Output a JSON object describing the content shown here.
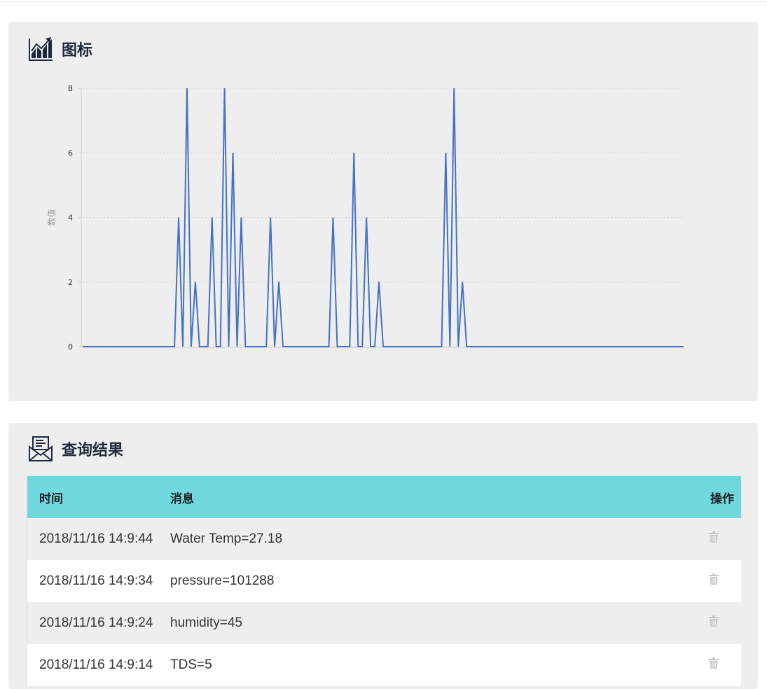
{
  "chart_panel": {
    "title": "图标",
    "icon": "trending-chart-icon"
  },
  "chart_data": {
    "type": "line",
    "ylabel": "数值",
    "ylim": [
      0,
      8
    ],
    "yticks": [
      0,
      2,
      4,
      6,
      8
    ],
    "grid": true,
    "color": "#4472c4",
    "values": [
      0,
      0,
      0,
      0,
      0,
      0,
      0,
      0,
      0,
      0,
      0,
      0,
      0,
      0,
      0,
      0,
      0,
      0,
      0,
      0,
      0,
      0,
      0,
      4,
      0,
      8,
      0,
      2,
      0,
      0,
      0,
      4,
      0,
      0,
      8,
      0,
      6,
      0,
      4,
      0,
      0,
      0,
      0,
      0,
      0,
      4,
      0,
      2,
      0,
      0,
      0,
      0,
      0,
      0,
      0,
      0,
      0,
      0,
      0,
      0,
      4,
      0,
      0,
      0,
      0,
      6,
      0,
      0,
      4,
      0,
      0,
      2,
      0,
      0,
      0,
      0,
      0,
      0,
      0,
      0,
      0,
      0,
      0,
      0,
      0,
      0,
      0,
      6,
      0,
      8,
      0,
      2,
      0,
      0,
      0,
      0,
      0,
      0,
      0,
      0,
      0,
      0,
      0,
      0,
      0,
      0,
      0,
      0,
      0,
      0,
      0,
      0,
      0,
      0,
      0,
      0,
      0,
      0,
      0,
      0,
      0,
      0,
      0,
      0,
      0,
      0,
      0,
      0,
      0,
      0,
      0,
      0,
      0,
      0,
      0,
      0,
      0,
      0,
      0,
      0,
      0,
      0,
      0,
      0,
      0
    ]
  },
  "results_panel": {
    "title": "查询结果",
    "icon": "envelope-message-icon",
    "columns": [
      "时间",
      "消息",
      "操作"
    ],
    "rows": [
      {
        "time": "2018/11/16 14:9:44",
        "message": "Water Temp=27.18"
      },
      {
        "time": "2018/11/16 14:9:34",
        "message": "pressure=101288"
      },
      {
        "time": "2018/11/16 14:9:24",
        "message": "humidity=45"
      },
      {
        "time": "2018/11/16 14:9:14",
        "message": "TDS=5"
      }
    ],
    "delete_icon": "trash-icon"
  }
}
